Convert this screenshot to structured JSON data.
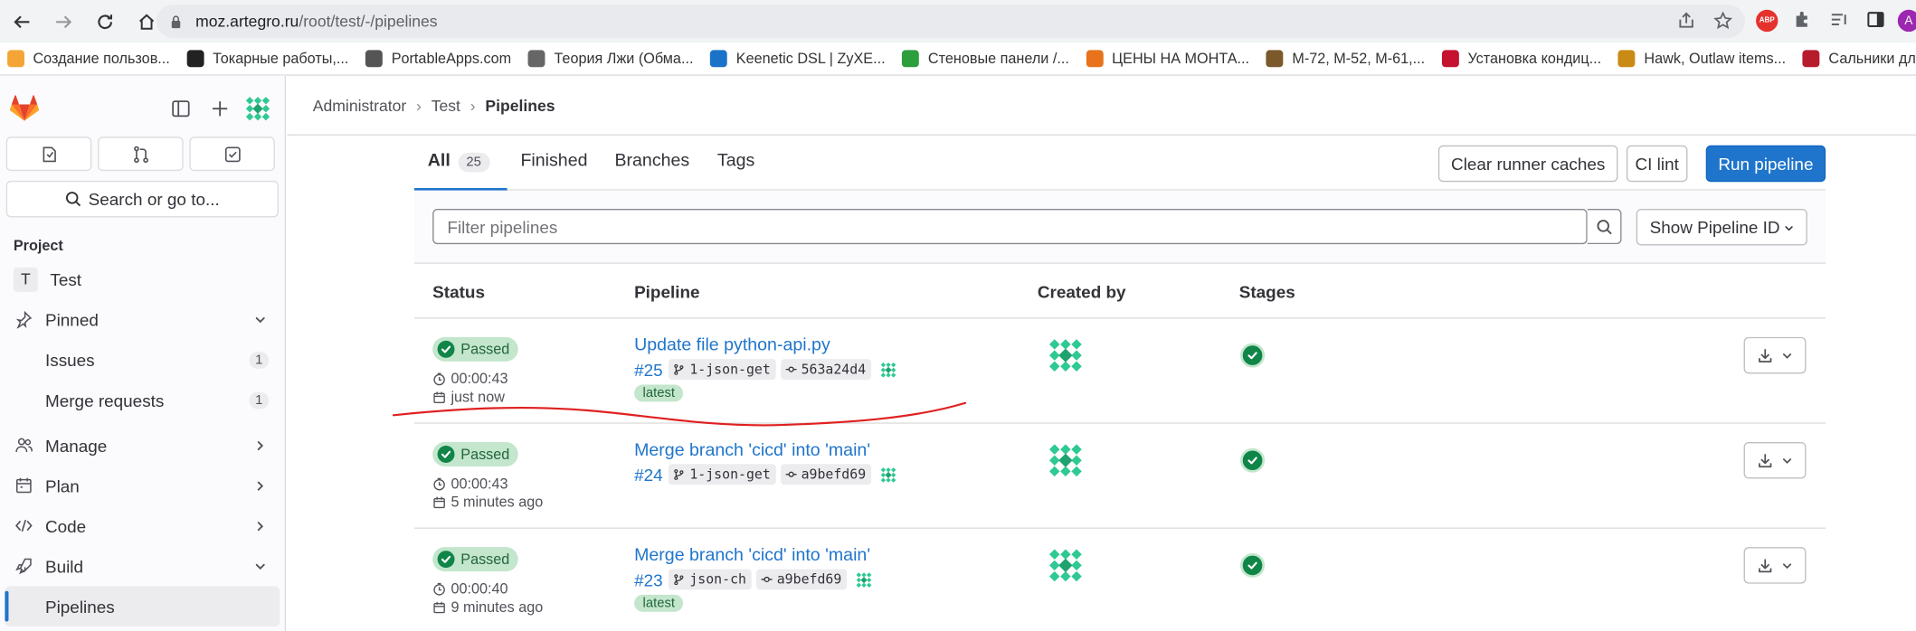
{
  "browser": {
    "url_host": "moz.artegro.ru",
    "url_path": "/root/test/-/pipelines",
    "bookmarks": [
      {
        "label": "Создание пользов...",
        "color": "#f4a535"
      },
      {
        "label": "Токарные работы,...",
        "color": "#222222"
      },
      {
        "label": "PortableApps.com",
        "color": "#555555"
      },
      {
        "label": "Теория Лжи (Обма...",
        "color": "#666666"
      },
      {
        "label": "Keenetic DSL | ZyXE...",
        "color": "#1a73c8"
      },
      {
        "label": "Стеновые панели /...",
        "color": "#2e9e3c"
      },
      {
        "label": "ЦЕНЫ НА МОНТА...",
        "color": "#e8731c"
      },
      {
        "label": "М-72, М-52, М-61,...",
        "color": "#7a5a2a"
      },
      {
        "label": "Установка кондиц...",
        "color": "#c4122f"
      },
      {
        "label": "Hawk, Outlaw items...",
        "color": "#c98b16"
      },
      {
        "label": "Сальники для отеч...",
        "color": "#b61c2c"
      }
    ],
    "ext_abp": "ABP",
    "profile_initial": "A"
  },
  "sidebar": {
    "search_label": "Search or go to...",
    "section_label": "Project",
    "project_initial": "T",
    "project_name": "Test",
    "pinned_label": "Pinned",
    "issues_label": "Issues",
    "issues_count": "1",
    "mr_label": "Merge requests",
    "mr_count": "1",
    "manage_label": "Manage",
    "plan_label": "Plan",
    "code_label": "Code",
    "build_label": "Build",
    "pipelines_label": "Pipelines"
  },
  "breadcrumb": {
    "items": [
      "Administrator",
      "Test"
    ],
    "current": "Pipelines"
  },
  "tabs": {
    "all_label": "All",
    "all_count": "25",
    "finished_label": "Finished",
    "branches_label": "Branches",
    "tags_label": "Tags"
  },
  "actions": {
    "clear_caches": "Clear runner caches",
    "ci_lint": "CI lint",
    "run_pipeline": "Run pipeline"
  },
  "filter": {
    "placeholder": "Filter pipelines",
    "show_id": "Show Pipeline ID"
  },
  "table": {
    "headers": {
      "status": "Status",
      "pipeline": "Pipeline",
      "created_by": "Created by",
      "stages": "Stages"
    },
    "rows": [
      {
        "status": "Passed",
        "duration": "00:00:43",
        "when": "just now",
        "title": "Update file python-api.py",
        "id": "#25",
        "branch": "1-json-get",
        "commit": "563a24d4",
        "tag": "latest"
      },
      {
        "status": "Passed",
        "duration": "00:00:43",
        "when": "5 minutes ago",
        "title": "Merge branch 'cicd' into 'main'",
        "id": "#24",
        "branch": "1-json-get",
        "commit": "a9befd69",
        "tag": ""
      },
      {
        "status": "Passed",
        "duration": "00:00:40",
        "when": "9 minutes ago",
        "title": "Merge branch 'cicd' into 'main'",
        "id": "#23",
        "branch": "json-ch",
        "commit": "a9befd69",
        "tag": "latest"
      }
    ]
  },
  "colors": {
    "primary": "#1f75cb",
    "success": "#108548",
    "success_bg": "#c3e6cd",
    "annotation": "#e02020"
  }
}
